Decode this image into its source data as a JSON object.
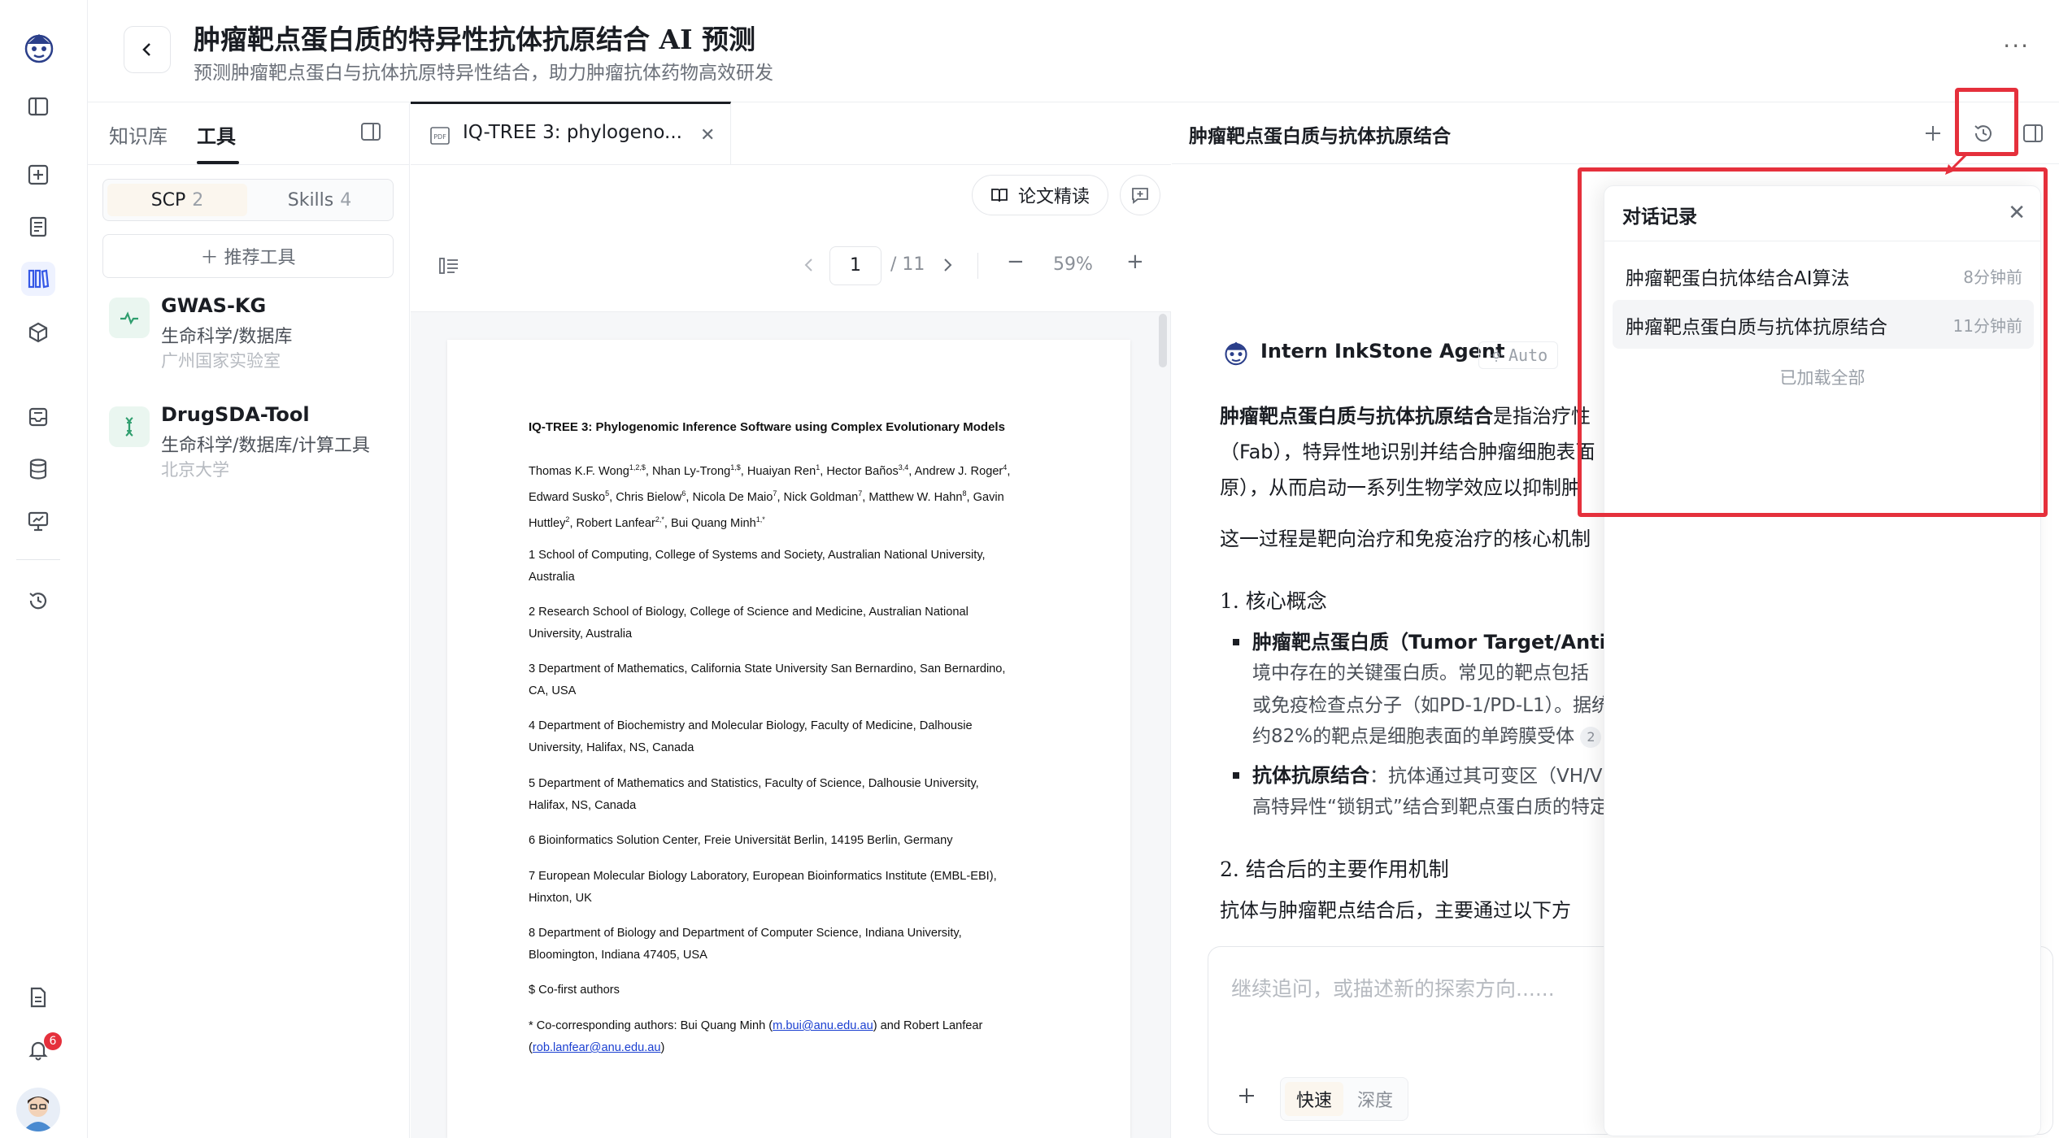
{
  "header": {
    "title": "肿瘤靶点蛋白质的特异性抗体抗原结合 AI 预测",
    "subtitle": "预测肿瘤靶点蛋白与抗体抗原特异性结合，助力肿瘤抗体药物高效研发",
    "more": "···"
  },
  "rail": {
    "notification_count": "6"
  },
  "left_panel": {
    "tabs": [
      {
        "label": "知识库"
      },
      {
        "label": "工具"
      }
    ],
    "segments": [
      {
        "label": "SCP",
        "count": "2"
      },
      {
        "label": "Skills",
        "count": "4"
      }
    ],
    "recommend_button": "＋  推荐工具",
    "tools": [
      {
        "name": "GWAS-KG",
        "category": "生命科学/数据库",
        "org": "广州国家实验室"
      },
      {
        "name": "DrugSDA-Tool",
        "category": "生命科学/数据库/计算工具",
        "org": "北京大学"
      }
    ]
  },
  "doc": {
    "tab_label": "IQ-TREE 3: phylogeno...",
    "read_button": "论文精读",
    "page_current": "1",
    "page_total": "/ 11",
    "zoom": "59%",
    "zoom_minus": "−",
    "zoom_plus": "+",
    "paper": {
      "title": "IQ-TREE 3: Phylogenomic Inference Software using Complex Evolutionary Models",
      "authors_1": "Thomas K.F. Wong",
      "authors_1_sup": "1,2,$",
      "authors_2": ", Nhan Ly-Trong",
      "authors_2_sup": "1,$",
      "authors_3": ", Huaiyan Ren",
      "authors_3_sup": "1",
      "authors_4": ", Hector Baños",
      "authors_4_sup": "3,4",
      "authors_5": ", Andrew J. Roger",
      "authors_5_sup": "4",
      "authors_6": ",",
      "authors_line2": "Edward Susko",
      "authors_line2_sup": "5",
      "authors_line2b": ", Chris Bielow",
      "authors_line2b_sup": "6",
      "authors_line2c": ", Nicola De Maio",
      "authors_line2c_sup": "7",
      "authors_line2d": ", Nick Goldman",
      "authors_line2d_sup": "7",
      "authors_line2e": ", Matthew W. Hahn",
      "authors_line2e_sup": "8",
      "authors_line2f": ", Gavin",
      "authors_line3": "Huttley",
      "authors_line3_sup": "2",
      "authors_line3b": ", Robert Lanfear",
      "authors_line3b_sup": "2,*",
      "authors_line3c": ", Bui Quang Minh",
      "authors_line3c_sup": "1,*",
      "affiliations": [
        [
          "1 School of Computing, College of Systems and Society, Australian National University,",
          "Australia"
        ],
        [
          "2 Research School of Biology, College of Science and Medicine, Australian National",
          "University, Australia"
        ],
        [
          "3 Department of Mathematics, California State University San Bernardino, San Bernardino,",
          "CA, USA"
        ],
        [
          "4 Department of Biochemistry and Molecular Biology, Faculty of Medicine, Dalhousie",
          "University, Halifax, NS, Canada"
        ],
        [
          "5 Department of Mathematics and Statistics, Faculty of Science, Dalhousie University,",
          "Halifax, NS, Canada"
        ],
        [
          "6 Bioinformatics Solution Center, Freie Universität Berlin, 14195 Berlin, Germany"
        ],
        [
          "7 European Molecular Biology Laboratory, European Bioinformatics Institute (EMBL-EBI),",
          "Hinxton, UK"
        ],
        [
          "8 Department of Biology and Department of Computer Science, Indiana University,",
          "Bloomington, Indiana 47405, USA"
        ],
        [
          "$ Co-first authors"
        ]
      ],
      "corr_1": "* Co-corresponding authors: Bui Quang Minh (",
      "corr_email_1": "m.bui@anu.edu.au",
      "corr_2": ") and Robert Lanfear",
      "corr_3": "(",
      "corr_email_2": "rob.lanfear@anu.edu.au",
      "corr_4": ")"
    }
  },
  "chat": {
    "title": "肿瘤靶点蛋白质与抗体抗原结合",
    "agent_name": "Intern InkStone Agent",
    "agent_mode": "Auto",
    "para1_bold": "肿瘤靶点蛋白质与抗体抗原结合",
    "para1_rest": "是指治疗性",
    "para1_line2": "（Fab），特异性地识别并结合肿瘤细胞表面",
    "para1_line3": "原），从而启动一系列生物学效应以抑制肿",
    "para2": "这一过程是靶向治疗和免疫治疗的核心机制",
    "h1": "1. 核心概念",
    "b1_bold": "肿瘤靶点蛋白质（Tumor Target/Antigen",
    "b1_l2": "境中存在的关键蛋白质。常见的靶点包括",
    "b1_l3": "或免疫检查点分子（如PD-1/PD-L1）。据统",
    "b1_l4": "约82%的靶点是细胞表面的单跨膜受体",
    "b1_cite": "2",
    "b2_bold": "抗体抗原结合",
    "b2_rest": "：抗体通过其可变区（VH/V",
    "b2_l2": "高特异性“锁钥式”结合到靶点蛋白质的特定",
    "h2": "2. 结合后的主要作用机制",
    "para3": "抗体与肿瘤靶点结合后，主要通过以下方",
    "input_placeholder": "继续追问，或描述新的探索方向......",
    "mode_fast": "快速",
    "mode_deep": "深度"
  },
  "history": {
    "title": "对话记录",
    "items": [
      {
        "label": "肿瘤靶蛋白抗体结合AI算法",
        "time": "8分钟前"
      },
      {
        "label": "肿瘤靶点蛋白质与抗体抗原结合",
        "time": "11分钟前"
      }
    ],
    "loaded_all": "已加载全部"
  },
  "colors": {
    "annotation_red": "#e5303c",
    "accent_blue": "#3558e6"
  }
}
